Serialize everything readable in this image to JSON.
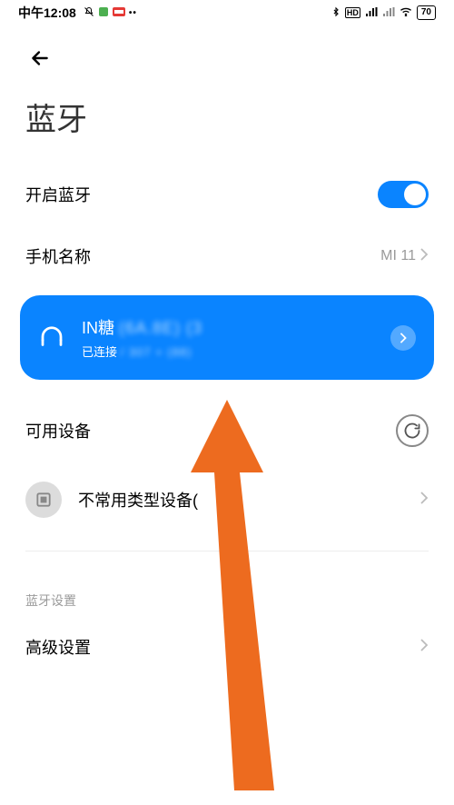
{
  "status_bar": {
    "time": "中午12:08",
    "battery_text": "70"
  },
  "page_title": "蓝牙",
  "bluetooth_switch": {
    "label": "开启蓝牙",
    "on": true
  },
  "phone_name": {
    "label": "手机名称",
    "value": "MI 11"
  },
  "connected_device": {
    "name": "IN糖",
    "name_blur": "(6A.8E) (3",
    "status": "已连接",
    "status_blur": "/ 307 + (88)"
  },
  "available_devices": {
    "title": "可用设备"
  },
  "uncommon_devices": {
    "label": "不常用类型设备("
  },
  "bluetooth_settings_section": "蓝牙设置",
  "advanced_settings": {
    "label": "高级设置"
  }
}
